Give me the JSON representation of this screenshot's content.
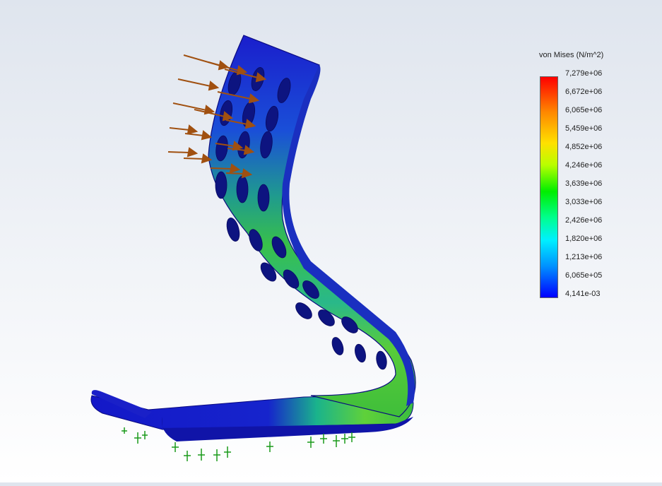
{
  "legend": {
    "title": "von Mises (N/m^2)",
    "labels": [
      "7,279e+06",
      "6,672e+06",
      "6,065e+06",
      "5,459e+06",
      "4,852e+06",
      "4,246e+06",
      "3,639e+06",
      "3,033e+06",
      "2,426e+06",
      "1,820e+06",
      "1,213e+06",
      "6,065e+05",
      "4,141e-03"
    ],
    "colors": [
      "#ff0000",
      "#ff8800",
      "#ffe000",
      "#b8ff00",
      "#00ee00",
      "#00ff90",
      "#00f0ff",
      "#0090ff",
      "#0000ff"
    ]
  },
  "viewport": {
    "model_name": "phone-stand-stress-plot",
    "load_arrow_color": "#a05010",
    "fixture_color": "#1a9a1a"
  }
}
